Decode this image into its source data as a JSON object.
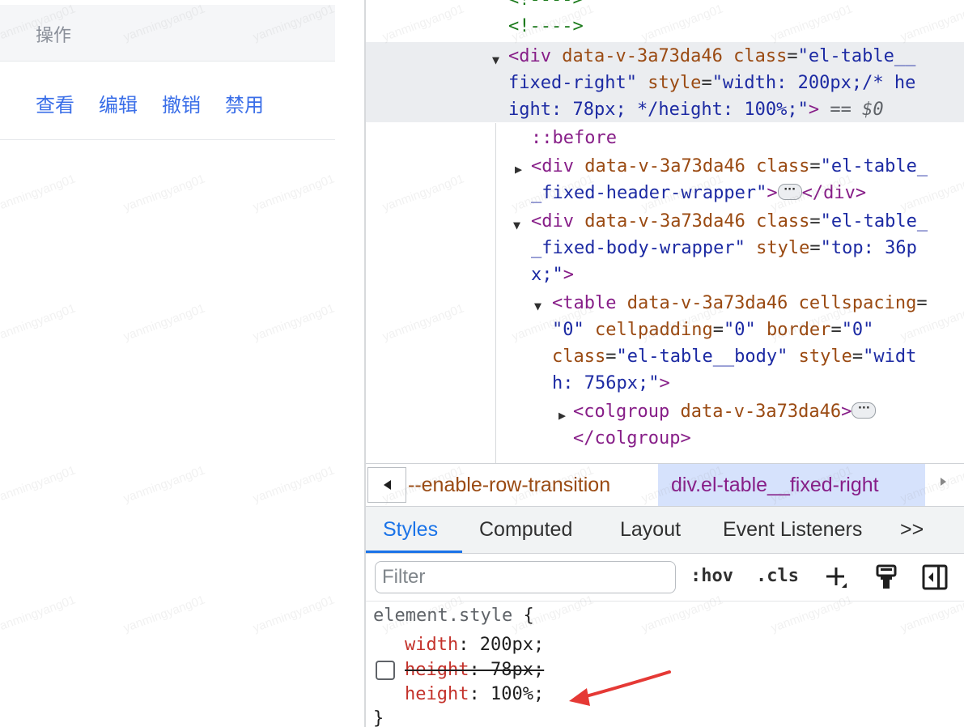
{
  "table": {
    "header_label": "操作",
    "actions": [
      "查看",
      "编辑",
      "撤销",
      "禁用"
    ]
  },
  "elements_tree": {
    "comment_top": "<!---->",
    "comment2": "<!---->",
    "selected_div": {
      "tag_open": "<div",
      "attr1_name": "data-v-3a73da46",
      "attr2_name": "class",
      "attr2_value_part1": "\"el-table__",
      "attr2_value_part2": "fixed-right\"",
      "attr3_name": "style",
      "attr3_value_part1": "\"width: 200px;/* he",
      "attr3_value_part2": "ight: 78px; */height: 100%;\"",
      "close": ">",
      "eq": "==",
      "dollar": "$0"
    },
    "before": "::before",
    "header_wrapper": {
      "tag_open": "<div",
      "attr1_name": "data-v-3a73da46",
      "attr2_name": "class",
      "value_part1": "\"el-table_",
      "value_part2": "_fixed-header-wrapper\"",
      "close_tag": "</div>",
      "ellipsis": "···"
    },
    "body_wrapper": {
      "tag_open": "<div",
      "attr1_name": "data-v-3a73da46",
      "attr2_name": "class",
      "value_part1": "\"el-table_",
      "value_part2": "_fixed-body-wrapper\"",
      "attr3_name": "style",
      "attr3_value_part1": "\"top: 36p",
      "attr3_value_part2": "x;\""
    },
    "table_el": {
      "tag_open": "<table",
      "attr1_name": "data-v-3a73da46",
      "attr2_name": "cellspacing",
      "attr2_eq": "=",
      "attr2_value": "\"0\"",
      "attr3_name": "cellpadding",
      "attr3_value": "\"0\"",
      "attr4_name": "border",
      "attr4_value": "\"0\"",
      "attr5_name": "class",
      "attr5_value": "\"el-table__body\"",
      "attr6_name": "style",
      "attr6_value_part1": "\"widt",
      "attr6_value_part2": "h: 756px;\""
    },
    "colgroup": {
      "tag_open": "<colgroup",
      "attr1_name": "data-v-3a73da46",
      "close_tag": "</colgroup>",
      "ellipsis": "···"
    }
  },
  "breadcrumbs": [
    "--enable-row-transition",
    "div.el-table__fixed-right"
  ],
  "tabs": [
    "Styles",
    "Computed",
    "Layout",
    "Event Listeners",
    ">>"
  ],
  "filter": {
    "placeholder": "Filter"
  },
  "toolbar": {
    "hov": ":hov",
    "cls": ".cls"
  },
  "styles_pane": {
    "selector": "element.style",
    "open_brace": "{",
    "close_brace": "}",
    "rules": [
      {
        "prop": "width",
        "value": "200px;"
      },
      {
        "prop": "height",
        "value": "78px;",
        "overridden": true
      },
      {
        "prop": "height",
        "value": "100%;"
      }
    ]
  },
  "watermark": "yanmingyang01",
  "colors": {
    "accent": "#1a73e8",
    "link": "#3a6ee8",
    "annotation_arrow": "#e53935"
  }
}
